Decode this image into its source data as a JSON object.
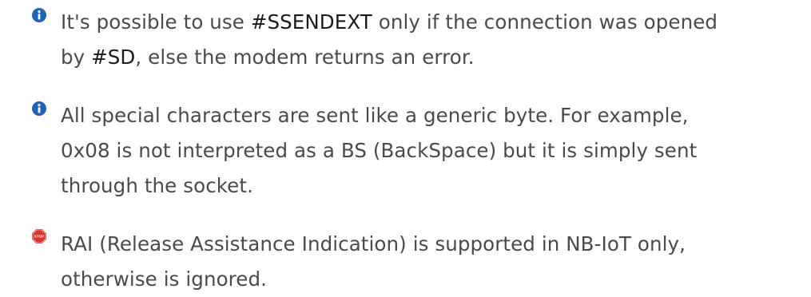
{
  "notes": [
    {
      "icon": "info-icon",
      "icon_color": "#1e63b4",
      "lines": [
        {
          "before": "It's possible to use ",
          "cmd": "#SSENDEXT",
          "after": " only if the connection was opened"
        },
        {
          "before": "by ",
          "cmd": "#SD",
          "after": ", else the modem returns an error."
        }
      ]
    },
    {
      "icon": "info-icon",
      "icon_color": "#1e63b4",
      "lines": [
        "All special characters are sent like a generic byte. For example,",
        "0x08 is not interpreted as a BS (BackSpace) but it is simply sent",
        "through the socket."
      ]
    },
    {
      "icon": "stop-sign-icon",
      "icon_color": "#d9342b",
      "icon_text": "STOP",
      "lines": [
        "RAI (Release Assistance Indication) is supported in NB-IoT only,",
        "otherwise is ignored."
      ]
    }
  ]
}
